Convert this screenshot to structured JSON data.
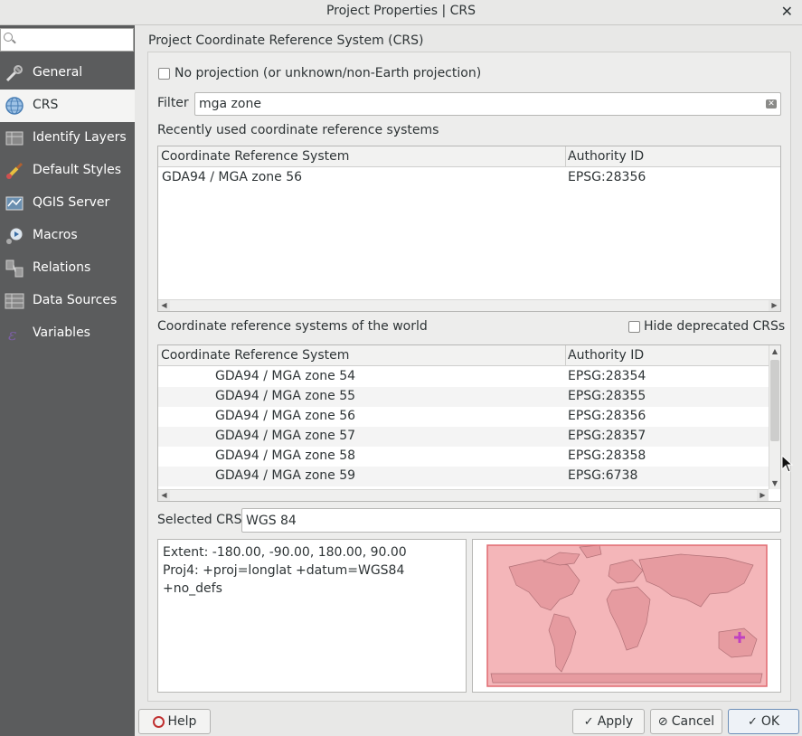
{
  "window": {
    "title": "Project Properties | CRS",
    "close_icon": "close-icon"
  },
  "sidebar": {
    "search": {
      "value": "",
      "placeholder": ""
    },
    "items": [
      {
        "label": "General",
        "icon": "wrench-icon",
        "active": false
      },
      {
        "label": "CRS",
        "icon": "globe-icon",
        "active": true
      },
      {
        "label": "Identify Layers",
        "icon": "identify-layers-icon",
        "active": false
      },
      {
        "label": "Default Styles",
        "icon": "paint-brush-icon",
        "active": false
      },
      {
        "label": "QGIS Server",
        "icon": "server-icon",
        "active": false
      },
      {
        "label": "Macros",
        "icon": "macros-icon",
        "active": false
      },
      {
        "label": "Relations",
        "icon": "relations-icon",
        "active": false
      },
      {
        "label": "Data Sources",
        "icon": "data-sources-icon",
        "active": false
      },
      {
        "label": "Variables",
        "icon": "variables-icon",
        "active": false
      }
    ]
  },
  "crs": {
    "section_title": "Project Coordinate Reference System (CRS)",
    "no_projection_label": "No projection (or unknown/non-Earth projection)",
    "filter_label": "Filter",
    "filter_value": "mga zone",
    "recent_label": "Recently used coordinate reference systems",
    "recent_table": {
      "headers": [
        "Coordinate Reference System",
        "Authority ID"
      ],
      "rows": [
        {
          "name": "GDA94 / MGA zone 56",
          "authid": "EPSG:28356"
        }
      ]
    },
    "world_label": "Coordinate reference systems of the world",
    "hide_deprecated_label": "Hide deprecated CRSs",
    "world_table": {
      "headers": [
        "Coordinate Reference System",
        "Authority ID"
      ],
      "rows": [
        {
          "name": "GDA94 / MGA zone 54",
          "authid": "EPSG:28354"
        },
        {
          "name": "GDA94 / MGA zone 55",
          "authid": "EPSG:28355"
        },
        {
          "name": "GDA94 / MGA zone 56",
          "authid": "EPSG:28356"
        },
        {
          "name": "GDA94 / MGA zone 57",
          "authid": "EPSG:28357"
        },
        {
          "name": "GDA94 / MGA zone 58",
          "authid": "EPSG:28358"
        },
        {
          "name": "GDA94 / MGA zone 59",
          "authid": "EPSG:6738"
        }
      ]
    },
    "selected_label": "Selected CRS",
    "selected_value": "WGS 84",
    "extent_text": "Extent: -180.00, -90.00, 180.00, 90.00",
    "proj4_text": "Proj4: +proj=longlat +datum=WGS84 +no_defs",
    "map_fill": "#f4b6b9",
    "map_border": "#e06a70",
    "marker_color": "#c040c0"
  },
  "buttons": {
    "help": "Help",
    "apply": "Apply",
    "cancel": "Cancel",
    "ok": "OK"
  }
}
